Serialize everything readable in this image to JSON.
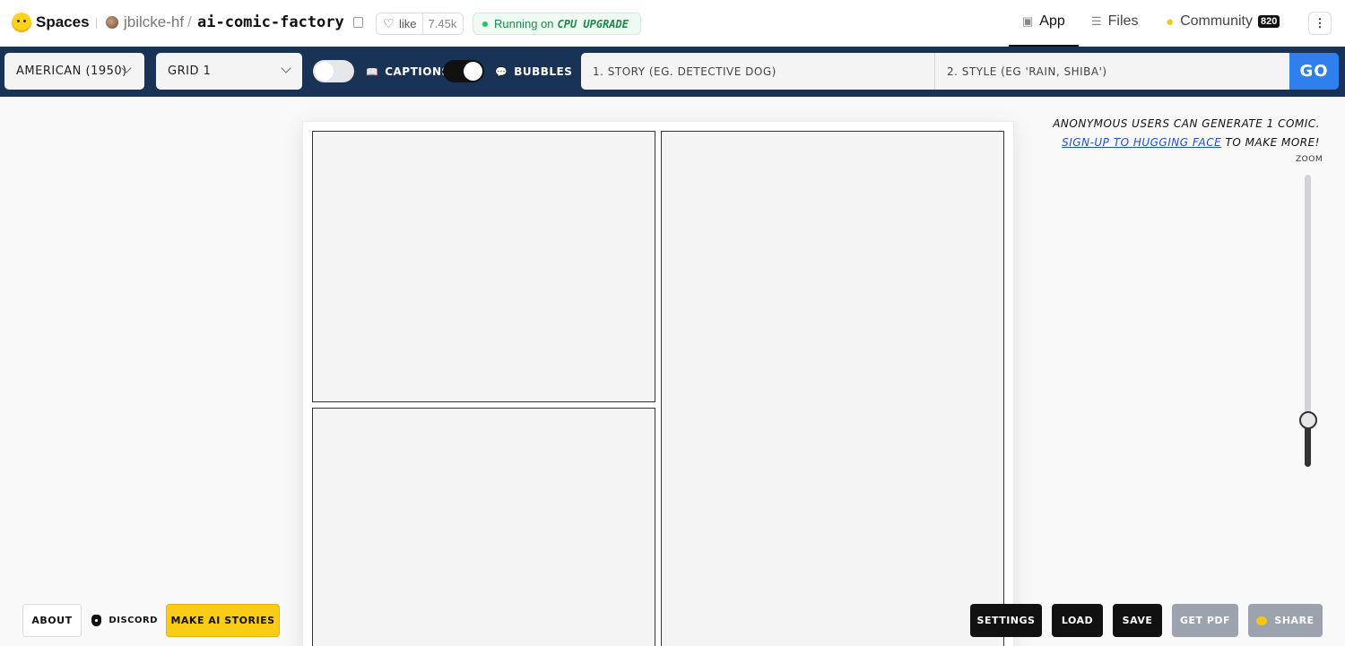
{
  "hf_header": {
    "brand": "Spaces",
    "owner": "jbilcke-hf",
    "slash": "/",
    "repo": "ai-comic-factory",
    "like_label": "like",
    "like_count": "7.45k",
    "running_label": "Running on",
    "hardware": "CPU UPGRADE",
    "tabs": [
      {
        "label": "App",
        "icon": "app-cube-icon"
      },
      {
        "label": "Files",
        "icon": "files-icon"
      },
      {
        "label": "Community",
        "icon": "community-icon",
        "badge": "820"
      }
    ]
  },
  "toolbar": {
    "style_select": "American (1950)",
    "layout_select": "Grid 1",
    "captions_label": "Captions",
    "captions_on": false,
    "bubbles_label": "Bubbles",
    "bubbles_on": true,
    "story_placeholder": "1. Story (eg. detective dog)",
    "style_placeholder": "2. Style (eg 'rain, shiba')",
    "go_label": "Go",
    "go_color": "#2f80ed",
    "bar_color": "#183356"
  },
  "notice": {
    "line1": "Anonymous users can generate 1 comic.",
    "link": "Sign-up to Hugging Face",
    "line2_suffix": " to make more!"
  },
  "zoom": {
    "label": "zoom",
    "level_percent": 16
  },
  "comic": {
    "panel_count": 3
  },
  "bottom_left": {
    "about": "About",
    "discord": "Discord",
    "make_stories": "Make AI stories"
  },
  "bottom_right": {
    "settings": "Settings",
    "load": "Load",
    "save": "Save",
    "get_pdf": "Get PDF",
    "share": "Share"
  }
}
